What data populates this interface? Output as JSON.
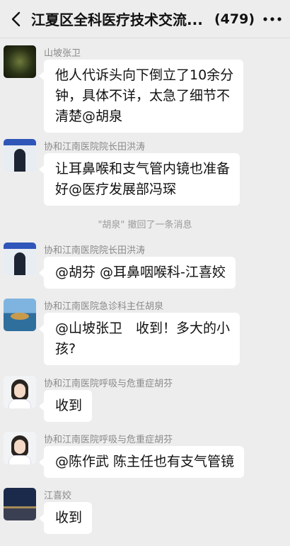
{
  "header": {
    "title": "江夏区全科医疗技术交流...",
    "count": "(479)",
    "back_icon": "chevron-left-icon",
    "more_icon": "ellipsis-icon"
  },
  "messages": [
    {
      "sender": "山坡张卫",
      "lines": [
        "他人代诉头向下倒立了10余分",
        "钟，具体不详，太急了细节不",
        "清楚@胡泉"
      ]
    },
    {
      "sender": "协和江南医院院长田洪涛",
      "lines": [
        "让耳鼻喉和支气管内镜也准备",
        "好@医疗发展部冯琛"
      ]
    },
    {
      "sender": "协和江南医院院长田洪涛",
      "lines": [
        "@胡芬 @耳鼻咽喉科-江喜姣"
      ]
    },
    {
      "sender": "协和江南医院急诊科主任胡泉",
      "lines": [
        "@山坡张卫　收到！多大的小",
        "孩?"
      ]
    },
    {
      "sender": "协和江南医院呼吸与危重症胡芬",
      "lines": [
        "收到"
      ]
    },
    {
      "sender": "协和江南医院呼吸与危重症胡芬",
      "lines": [
        "@陈作武 陈主任也有支气管镜"
      ]
    },
    {
      "sender": "江喜姣",
      "lines": [
        "收到"
      ]
    }
  ],
  "system_notice": "\"胡泉\" 撤回了一条消息"
}
